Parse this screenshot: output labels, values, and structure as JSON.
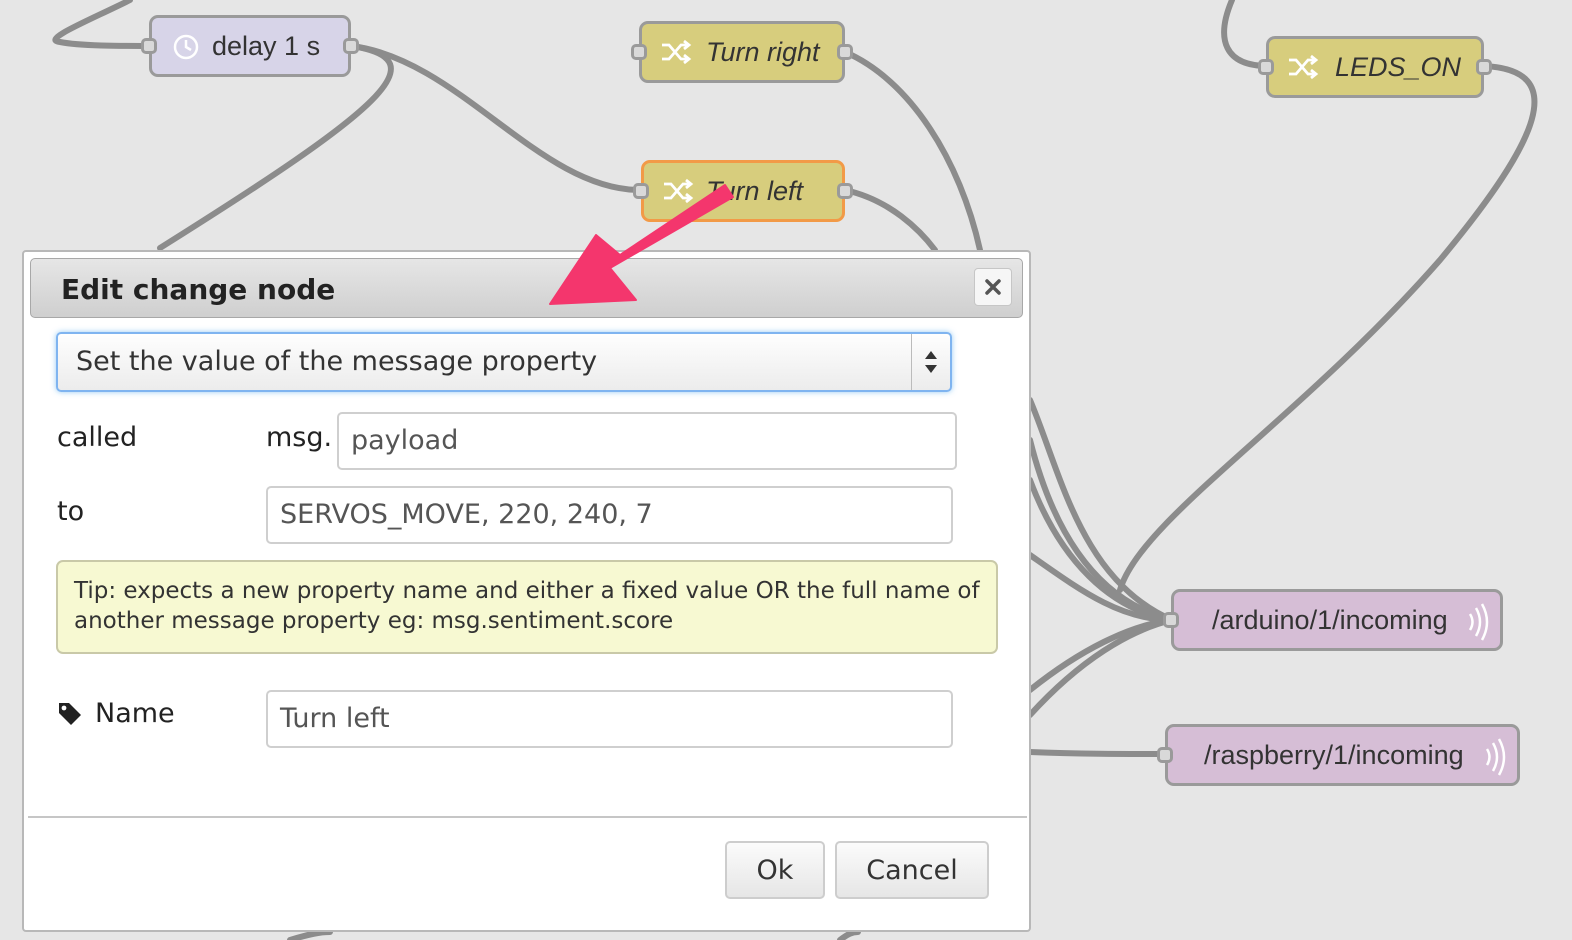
{
  "flow_nodes": [
    {
      "id": "delay",
      "label": "delay 1 s",
      "icon": "timer-icon",
      "color": "#d7d4e8"
    },
    {
      "id": "turn-right",
      "label": "Turn right",
      "icon": "shuffle-icon",
      "color": "#d7cd7d"
    },
    {
      "id": "turn-left",
      "label": "Turn left",
      "icon": "shuffle-icon",
      "color": "#d7cd7d",
      "selected_border": "#f29a47"
    },
    {
      "id": "leds-on",
      "label": "LEDS_ON",
      "icon": "shuffle-icon",
      "color": "#d7cd7d"
    },
    {
      "id": "arduino",
      "label": "/arduino/1/incoming",
      "icon": "broadcast-icon",
      "color": "#d6bed6"
    },
    {
      "id": "raspberry",
      "label": "/raspberry/1/incoming",
      "icon": "broadcast-icon",
      "color": "#d6bed6"
    }
  ],
  "dialog": {
    "title": "Edit change node",
    "close_icon": "close-icon",
    "action_select": {
      "value": "Set the value of the message property",
      "icon": "select-arrows-icon"
    },
    "property": {
      "label": "called",
      "prefix": "msg.",
      "value": "payload"
    },
    "to": {
      "label": "to",
      "value": "SERVOS_MOVE, 220, 240, 7"
    },
    "tip": "Tip: expects a new property name and either a fixed value OR the full name of another message property eg: msg.sentiment.score",
    "name": {
      "label": "Name",
      "icon": "tag-icon",
      "value": "Turn left"
    },
    "ok_label": "Ok",
    "cancel_label": "Cancel"
  },
  "annotation": {
    "icon": "pointer-arrow-icon",
    "color": "#f4366d"
  }
}
